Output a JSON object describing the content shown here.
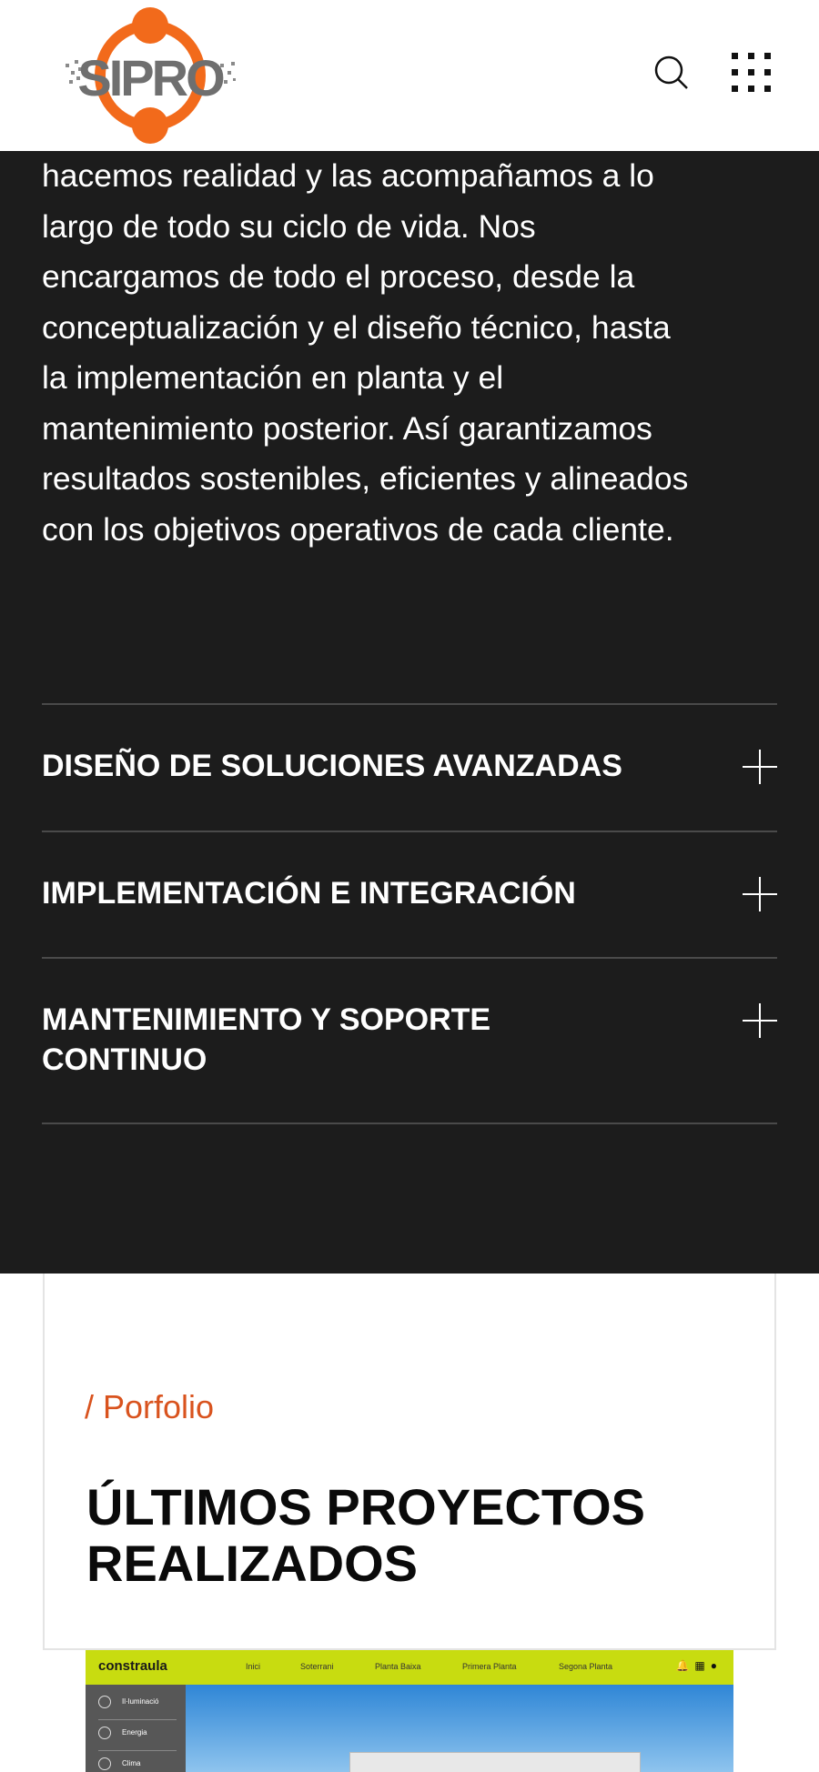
{
  "header": {
    "logo_text": "SIPRO",
    "search_icon": "search-icon",
    "menu_icon": "grid-menu-icon"
  },
  "intro": {
    "lines": [
      "hacemos realidad y las acompañamos a lo",
      "largo de todo su ciclo de vida. Nos",
      "encargamos de todo el proceso, desde la",
      "conceptualización y el diseño técnico, hasta",
      "la implementación en planta y el",
      "mantenimiento posterior. Así garantizamos",
      "resultados sostenibles, eficientes y alineados",
      "con los objetivos operativos de cada cliente."
    ]
  },
  "accordion": [
    {
      "title": "DISEÑO DE SOLUCIONES AVANZADAS",
      "icon": "plus-icon"
    },
    {
      "title": "IMPLEMENTACIÓN E INTEGRACIÓN",
      "icon": "plus-icon"
    },
    {
      "title": "MANTENIMIENTO Y SOPORTE CONTINUO",
      "icon": "plus-icon"
    }
  ],
  "portfolio": {
    "label": "/ Porfolio",
    "title": "ÚLTIMOS PROYECTOS REALIZADOS"
  },
  "preview": {
    "brand": "constraula",
    "nav": [
      "Inici",
      "Soterrani",
      "Planta Baixa",
      "Primera Planta",
      "Segona Planta"
    ],
    "side": [
      "Il·luminació",
      "Energia",
      "Clima"
    ]
  },
  "colors": {
    "dark_bg": "#1c1c1c",
    "accent": "#d9531e",
    "logo_orange": "#f26a1b",
    "preview_bar": "#c8dc10"
  }
}
